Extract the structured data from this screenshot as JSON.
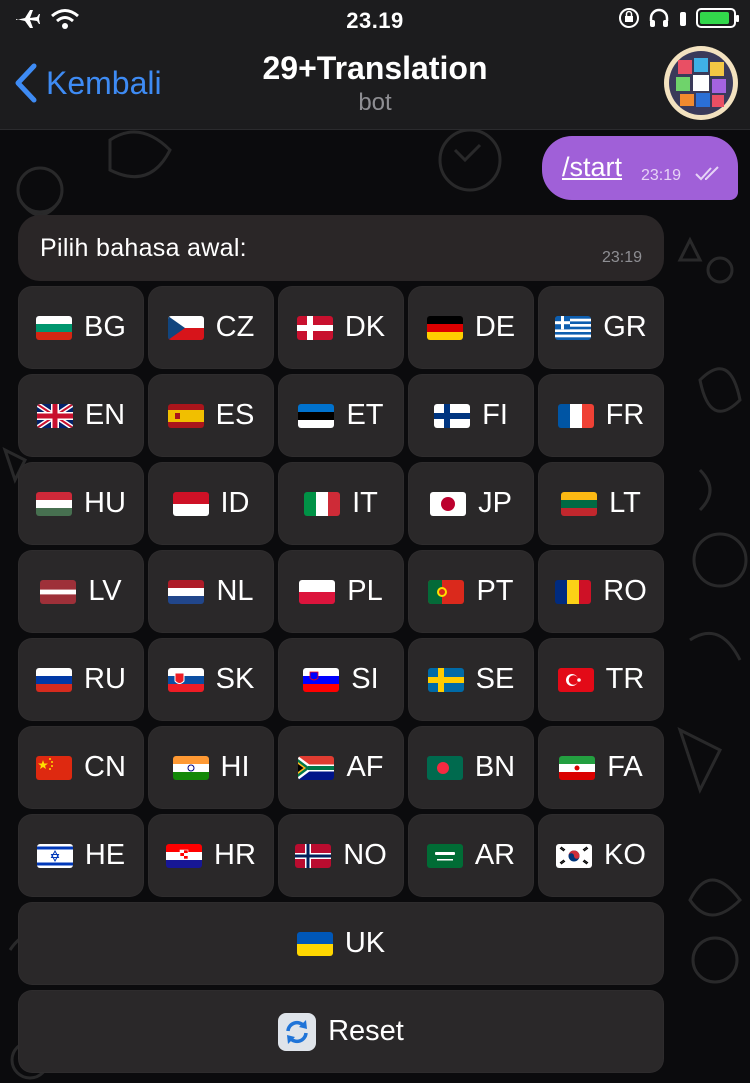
{
  "status": {
    "time": "23.19"
  },
  "nav": {
    "back_label": "Kembali",
    "title": "29+Translation",
    "subtitle": "bot"
  },
  "outgoing": {
    "text": "/start",
    "time": "23:19"
  },
  "incoming": {
    "text": "Pilih bahasa awal:",
    "time": "23:19"
  },
  "keyboard": {
    "rows": [
      [
        {
          "code": "BG",
          "flag": "bg"
        },
        {
          "code": "CZ",
          "flag": "cz"
        },
        {
          "code": "DK",
          "flag": "dk"
        },
        {
          "code": "DE",
          "flag": "de"
        },
        {
          "code": "GR",
          "flag": "gr"
        }
      ],
      [
        {
          "code": "EN",
          "flag": "gb"
        },
        {
          "code": "ES",
          "flag": "es"
        },
        {
          "code": "ET",
          "flag": "ee"
        },
        {
          "code": "FI",
          "flag": "fi"
        },
        {
          "code": "FR",
          "flag": "fr"
        }
      ],
      [
        {
          "code": "HU",
          "flag": "hu"
        },
        {
          "code": "ID",
          "flag": "id"
        },
        {
          "code": "IT",
          "flag": "it"
        },
        {
          "code": "JP",
          "flag": "jp"
        },
        {
          "code": "LT",
          "flag": "lt"
        }
      ],
      [
        {
          "code": "LV",
          "flag": "lv"
        },
        {
          "code": "NL",
          "flag": "nl"
        },
        {
          "code": "PL",
          "flag": "pl"
        },
        {
          "code": "PT",
          "flag": "pt"
        },
        {
          "code": "RO",
          "flag": "ro"
        }
      ],
      [
        {
          "code": "RU",
          "flag": "ru"
        },
        {
          "code": "SK",
          "flag": "sk"
        },
        {
          "code": "SI",
          "flag": "si"
        },
        {
          "code": "SE",
          "flag": "se"
        },
        {
          "code": "TR",
          "flag": "tr"
        }
      ],
      [
        {
          "code": "CN",
          "flag": "cn"
        },
        {
          "code": "HI",
          "flag": "in"
        },
        {
          "code": "AF",
          "flag": "za"
        },
        {
          "code": "BN",
          "flag": "bd"
        },
        {
          "code": "FA",
          "flag": "ir"
        }
      ],
      [
        {
          "code": "HE",
          "flag": "il"
        },
        {
          "code": "HR",
          "flag": "hr"
        },
        {
          "code": "NO",
          "flag": "no"
        },
        {
          "code": "AR",
          "flag": "sa"
        },
        {
          "code": "KO",
          "flag": "kr"
        }
      ]
    ],
    "uk": {
      "code": "UK",
      "flag": "ua"
    },
    "reset": {
      "label": "Reset",
      "icon": "refresh-icon"
    }
  },
  "colors": {
    "accent": "#3e8bf4",
    "outgoing_bubble": "#a060d8",
    "button_bg": "#2a2829"
  }
}
